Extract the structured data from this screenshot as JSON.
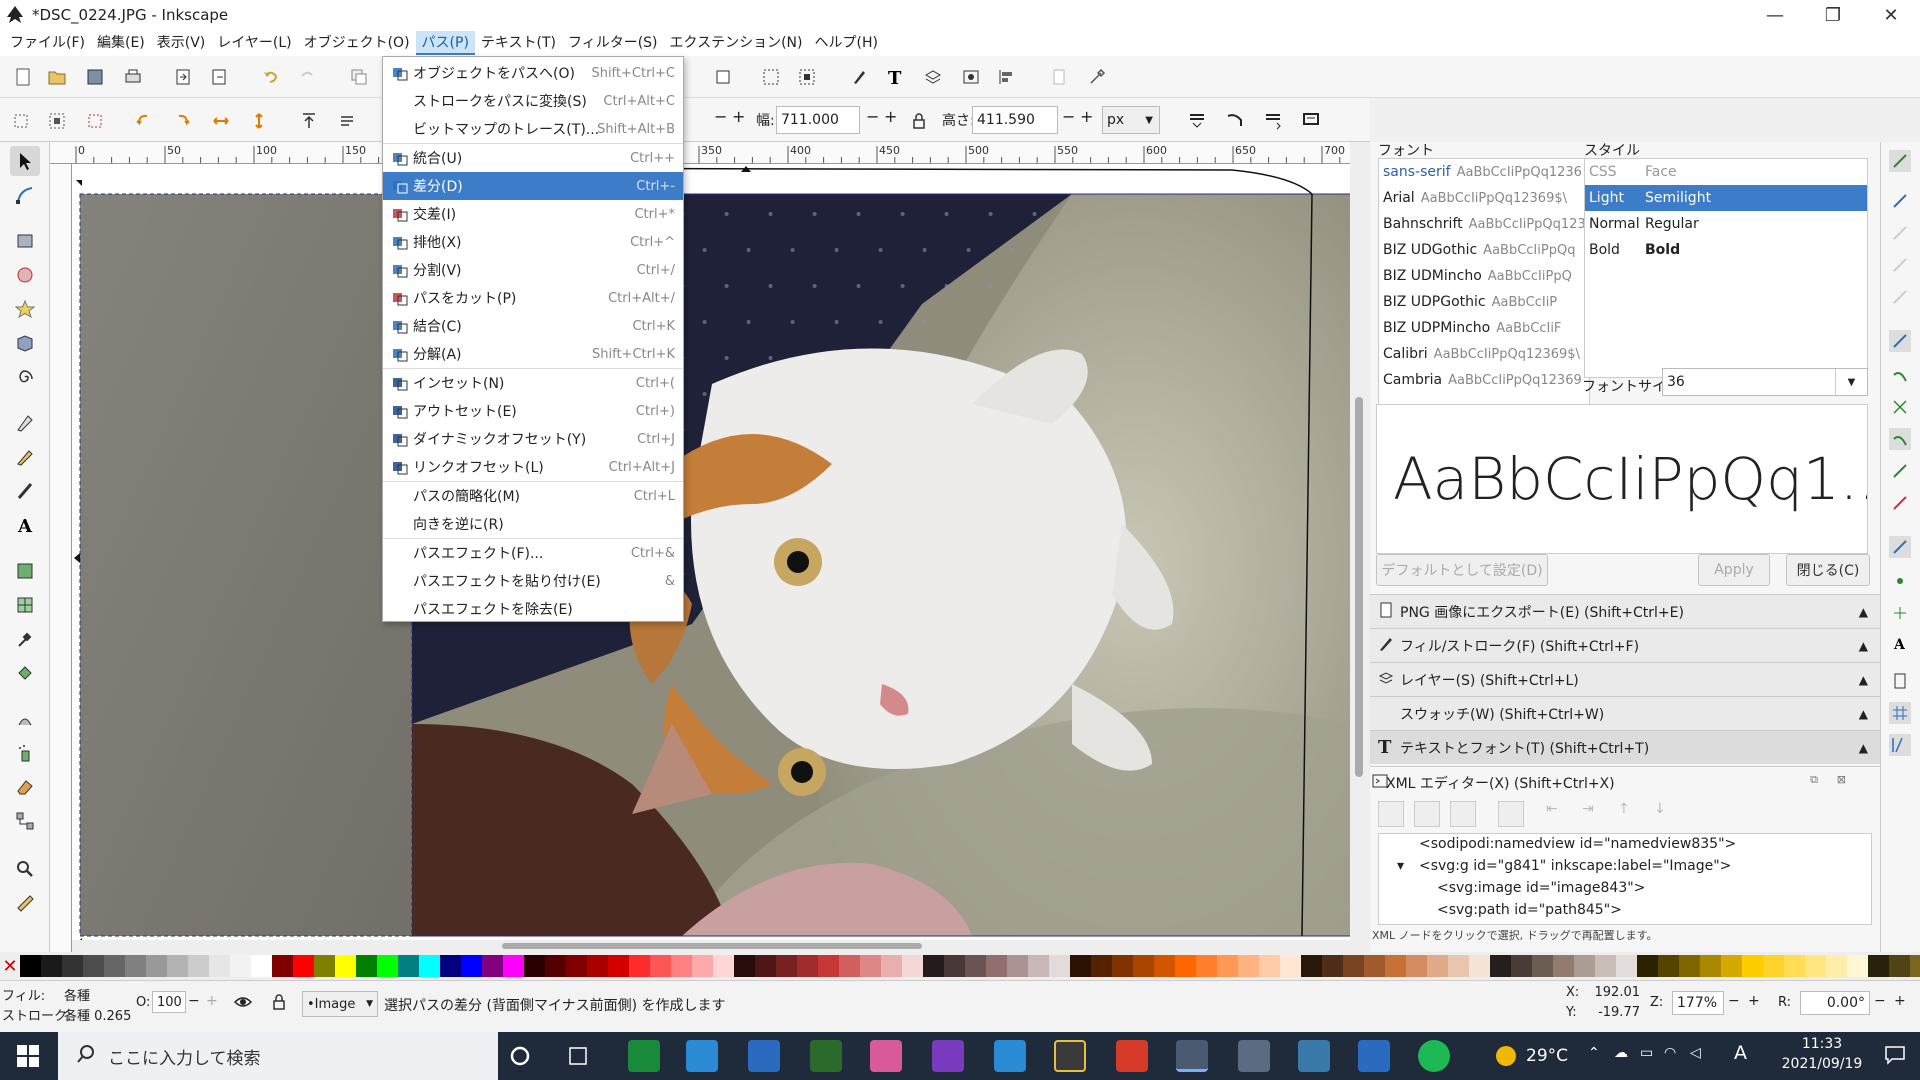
{
  "window": {
    "title": "*DSC_0224.JPG - Inkscape",
    "minimize": "—",
    "maximize": "❐",
    "close": "✕"
  },
  "menubar": {
    "items": [
      "ファイル(F)",
      "編集(E)",
      "表示(V)",
      "レイヤー(L)",
      "オブジェクト(O)",
      "パス(P)",
      "テキスト(T)",
      "フィルター(S)",
      "エクステンション(N)",
      "ヘルプ(H)"
    ],
    "active_index": 5
  },
  "path_menu": {
    "items": [
      {
        "label": "オブジェクトをパスへ(O)",
        "shortcut": "Shift+Ctrl+C",
        "icon": "object-to-path-icon"
      },
      {
        "label": "ストロークをパスに変換(S)",
        "shortcut": "Ctrl+Alt+C",
        "icon": ""
      },
      {
        "label": "ビットマップのトレース(T)...",
        "shortcut": "Shift+Alt+B",
        "icon": ""
      },
      {
        "label": "統合(U)",
        "shortcut": "Ctrl++",
        "icon": "union-icon"
      },
      {
        "label": "差分(D)",
        "shortcut": "Ctrl+-",
        "icon": "difference-icon",
        "highlighted": true
      },
      {
        "label": "交差(I)",
        "shortcut": "Ctrl+*",
        "icon": "intersection-icon"
      },
      {
        "label": "排他(X)",
        "shortcut": "Ctrl+^",
        "icon": "exclusion-icon"
      },
      {
        "label": "分割(V)",
        "shortcut": "Ctrl+/",
        "icon": "division-icon"
      },
      {
        "label": "パスをカット(P)",
        "shortcut": "Ctrl+Alt+/",
        "icon": "cut-path-icon"
      },
      {
        "label": "結合(C)",
        "shortcut": "Ctrl+K",
        "icon": "combine-icon"
      },
      {
        "label": "分解(A)",
        "shortcut": "Shift+Ctrl+K",
        "icon": "break-apart-icon"
      },
      {
        "label": "インセット(N)",
        "shortcut": "Ctrl+(",
        "icon": "inset-icon"
      },
      {
        "label": "アウトセット(E)",
        "shortcut": "Ctrl+)",
        "icon": "outset-icon"
      },
      {
        "label": "ダイナミックオフセット(Y)",
        "shortcut": "Ctrl+J",
        "icon": "dynamic-offset-icon"
      },
      {
        "label": "リンクオフセット(L)",
        "shortcut": "Ctrl+Alt+J",
        "icon": "linked-offset-icon"
      },
      {
        "label": "パスの簡略化(M)",
        "shortcut": "Ctrl+L",
        "icon": ""
      },
      {
        "label": "向きを逆に(R)",
        "shortcut": "",
        "icon": ""
      },
      {
        "label": "パスエフェクト(F)...",
        "shortcut": "Ctrl+&",
        "icon": ""
      },
      {
        "label": "パスエフェクトを貼り付け(E)",
        "shortcut": "&",
        "icon": ""
      },
      {
        "label": "パスエフェクトを除去(E)",
        "shortcut": "",
        "icon": ""
      }
    ]
  },
  "ctrlbar": {
    "width_label": "幅:",
    "width_value": "711.000",
    "height_label": "高さ:",
    "height_value": "411.590",
    "unit": "px"
  },
  "ruler": {
    "ticks": [
      "0",
      "50",
      "100",
      "150",
      "200",
      "250",
      "300",
      "350",
      "400",
      "450",
      "500",
      "550",
      "600",
      "650",
      "700"
    ]
  },
  "text_font_panel": {
    "font_header": "フォント",
    "style_header": "スタイル",
    "fonts": [
      {
        "name": "sans-serif",
        "sample": "AaBbCcIiPpQq1236"
      },
      {
        "name": "Arial",
        "sample": "AaBbCcIiPpQq12369$\\"
      },
      {
        "name": "Bahnschrift",
        "sample": "AaBbCcIiPpQq123"
      },
      {
        "name": "BIZ UDGothic",
        "sample": "AaBbCcIiPpQq"
      },
      {
        "name": "BIZ UDMincho",
        "sample": "AaBbCcIiPpQ"
      },
      {
        "name": "BIZ UDPGothic",
        "sample": "AaBbCcIiP"
      },
      {
        "name": "BIZ UDPMincho",
        "sample": "AaBbCcIiF"
      },
      {
        "name": "Calibri",
        "sample": "AaBbCcIiPpQq12369$\\"
      },
      {
        "name": "Cambria",
        "sample": "AaBbCcIiPpQq12369"
      }
    ],
    "style_cols": [
      "CSS",
      "Face"
    ],
    "styles": [
      {
        "css": "Light",
        "face": "Semilight",
        "selected": true
      },
      {
        "css": "Normal",
        "face": "Regular"
      },
      {
        "css": "Bold",
        "face": "Bold"
      }
    ],
    "font_size_label": "フォントサイズ",
    "font_size_value": "36",
    "preview": "AaBbCcIiPpQq1...",
    "set_default": "デフォルトとして設定(D)",
    "apply": "Apply",
    "close": "閉じる(C)"
  },
  "docks": [
    {
      "label": "PNG 画像にエクスポート(E) (Shift+Ctrl+E)",
      "icon": "export-png-icon"
    },
    {
      "label": "フィル/ストローク(F) (Shift+Ctrl+F)",
      "icon": "fill-stroke-icon"
    },
    {
      "label": "レイヤー(S) (Shift+Ctrl+L)",
      "icon": "layers-icon"
    },
    {
      "label": "スウォッチ(W) (Shift+Ctrl+W)",
      "icon": ""
    },
    {
      "label": "テキストとフォント(T) (Shift+Ctrl+T)",
      "icon": "text-font-icon"
    }
  ],
  "xml_editor": {
    "title": "XML エディター(X) (Shift+Ctrl+X)",
    "nodes": [
      "<sodipodi:namedview id=\"namedview835\">",
      "<svg:g id=\"g841\" inkscape:label=\"Image\">",
      "<svg:image id=\"image843\">",
      "<svg:path id=\"path845\">"
    ],
    "hint": "XML ノードをクリックで選択, ドラッグで再配置します。"
  },
  "palette": [
    "#000000",
    "#1a1a1a",
    "#333333",
    "#4d4d4d",
    "#666666",
    "#808080",
    "#999999",
    "#b3b3b3",
    "#cccccc",
    "#e6e6e6",
    "#f2f2f2",
    "#ffffff",
    "#800000",
    "#ff0000",
    "#808000",
    "#ffff00",
    "#008000",
    "#00ff00",
    "#008080",
    "#00ffff",
    "#000080",
    "#0000ff",
    "#800080",
    "#ff00ff",
    "#2b0000",
    "#550000",
    "#800000",
    "#aa0000",
    "#d40000",
    "#ff2a2a",
    "#ff5555",
    "#ff8080",
    "#ffaaaa",
    "#ffd5d5",
    "#280b0b",
    "#501616",
    "#782121",
    "#a02c2c",
    "#c83737",
    "#d35f5f",
    "#de8787",
    "#e9afaf",
    "#f4d7d7",
    "#241c1c",
    "#483737",
    "#6c5353",
    "#916f6f",
    "#ac9393",
    "#c8b7b7",
    "#e3dbdb",
    "#2b1100",
    "#552200",
    "#803300",
    "#aa4400",
    "#d45500",
    "#ff6600",
    "#ff7f2a",
    "#ff9955",
    "#ffb380",
    "#ffccaa",
    "#ffe6d5",
    "#28170b",
    "#502d16",
    "#784421",
    "#a05a2c",
    "#c87137",
    "#d38d5f",
    "#deaa87",
    "#e9c6af",
    "#f4e3d7",
    "#241f1c",
    "#483e37",
    "#6c5d53",
    "#917c6f",
    "#ac9d93",
    "#c8beb7",
    "#e3dedb",
    "#2b2200",
    "#554400",
    "#806600",
    "#aa8800",
    "#d4aa00",
    "#ffcc00",
    "#ffd42a",
    "#ffdd55",
    "#ffe680",
    "#ffeeaa",
    "#fff6d5",
    "#28220b",
    "#504416",
    "#786721",
    "#a0892c",
    "#c8ab37"
  ],
  "status": {
    "fill_label": "フィル:",
    "fill_value": "各種",
    "stroke_label": "ストローク:",
    "stroke_value": "各種 0.265",
    "opacity_label": "O:",
    "opacity_value": "100",
    "layer": "•Image",
    "message": "選択パスの差分 (背面側マイナス前面側) を作成します",
    "x_label": "X:",
    "x_value": "192.01",
    "y_label": "Y:",
    "y_value": "-19.77",
    "zoom_label": "Z:",
    "zoom_value": "177%",
    "rot_label": "R:",
    "rot_value": "0.00°"
  },
  "taskbar": {
    "search_placeholder": "ここに入力して検索",
    "temperature": "29°C",
    "time": "11:33",
    "date": "2021/09/19",
    "ime": "A"
  }
}
